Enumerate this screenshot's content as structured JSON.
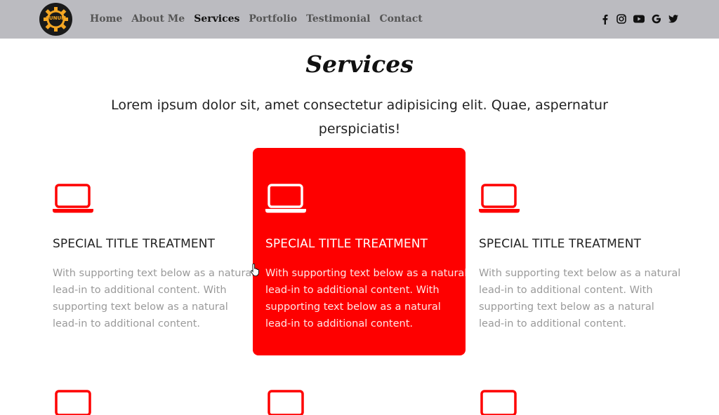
{
  "nav": {
    "logo_text": "SUNUM",
    "links": [
      "Home",
      "About Me",
      "Services",
      "Portfolio",
      "Testimonial",
      "Contact"
    ],
    "active": "Services",
    "social_icons": [
      "facebook-icon",
      "instagram-icon",
      "youtube-icon",
      "google-icon",
      "twitter-icon"
    ]
  },
  "section": {
    "title": "Services",
    "intro": "Lorem ipsum dolor sit, amet consectetur adipisicing elit. Quae, aspernatur perspiciatis!"
  },
  "cards": [
    {
      "icon": "laptop-icon",
      "title": "SPECIAL TITLE TREATMENT",
      "text": "With supporting text below as a natural lead-in to additional content. With supporting text below as a natural lead-in to additional content."
    },
    {
      "icon": "laptop-icon",
      "title": "SPECIAL TITLE TREATMENT",
      "text": "With supporting text below as a natural lead-in to additional content. With supporting text below as a natural lead-in to additional content.",
      "highlighted": true
    },
    {
      "icon": "laptop-icon",
      "title": "SPECIAL TITLE TREATMENT",
      "text": "With supporting text below as a natural lead-in to additional content. With supporting text below as a natural lead-in to additional content."
    }
  ],
  "colors": {
    "accent": "#fe0000",
    "navbar_bg": "#bbbbc0",
    "logo_accent": "#f5a623",
    "muted_text": "#9a9a9a"
  }
}
